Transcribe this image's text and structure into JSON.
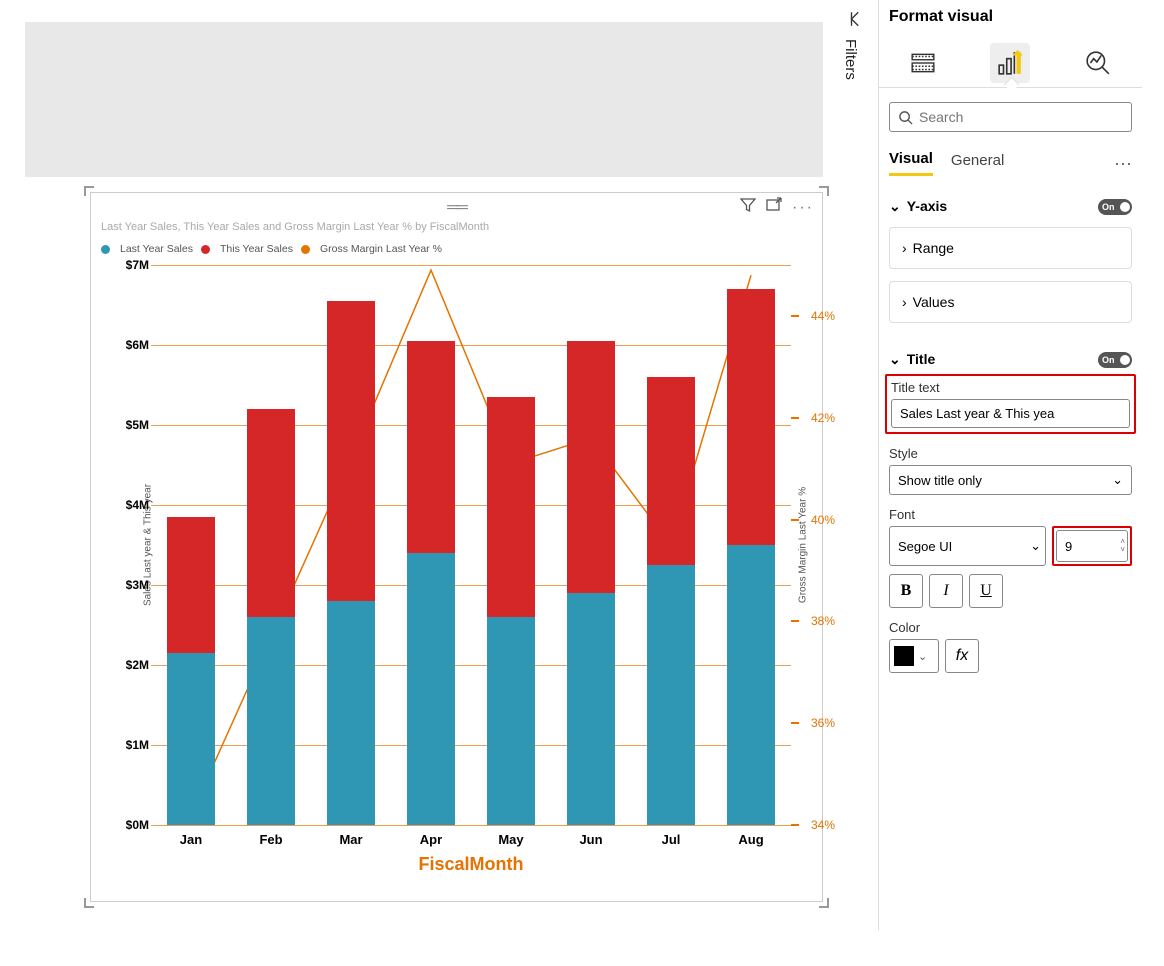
{
  "chart_data": {
    "type": "bar",
    "title_text": "Last Year Sales, This Year Sales and Gross Margin Last Year % by FiscalMonth",
    "xlabel": "FiscalMonth",
    "ylabel_left": "Sales Last year & This year",
    "ylabel_right": "Gross Margin Last Year %",
    "categories": [
      "Jan",
      "Feb",
      "Mar",
      "Apr",
      "May",
      "Jun",
      "Jul",
      "Aug"
    ],
    "y1_ticks": [
      "$0M",
      "$1M",
      "$2M",
      "$3M",
      "$4M",
      "$5M",
      "$6M",
      "$7M"
    ],
    "y1_range": [
      0,
      7
    ],
    "series": [
      {
        "name": "Last Year Sales",
        "color": "#2f96b4",
        "values": [
          2.15,
          2.6,
          2.8,
          3.4,
          2.6,
          2.9,
          3.25,
          3.5
        ]
      },
      {
        "name": "This Year Sales",
        "color": "#d62728",
        "values": [
          1.7,
          2.6,
          3.75,
          2.65,
          2.75,
          3.15,
          2.35,
          3.2
        ]
      }
    ],
    "y2_ticks": [
      "34%",
      "36%",
      "38%",
      "40%",
      "42%",
      "44%"
    ],
    "y2_range": [
      34,
      45
    ],
    "line_series": {
      "name": "Gross Margin Last Year %",
      "color": "#e67300",
      "values": [
        34.2,
        37.7,
        41.2,
        44.9,
        41.1,
        41.6,
        39.5,
        44.8
      ]
    },
    "legend": [
      {
        "label": "Last Year Sales",
        "color": "#2f96b4"
      },
      {
        "label": "This Year Sales",
        "color": "#d62728"
      },
      {
        "label": "Gross Margin Last Year %",
        "color": "#e67300"
      }
    ]
  },
  "filters_label": "Filters",
  "format_panel": {
    "title": "Format visual",
    "search_placeholder": "Search",
    "tabs": {
      "visual": "Visual",
      "general": "General"
    },
    "yaxis": {
      "label": "Y-axis",
      "toggle": "On",
      "range": "Range",
      "values": "Values"
    },
    "title_section": {
      "label": "Title",
      "toggle": "On",
      "title_text_label": "Title text",
      "title_text_value": "Sales Last year & This yea",
      "style_label": "Style",
      "style_value": "Show title only",
      "font_label": "Font",
      "font_family": "Segoe UI",
      "font_size": "9",
      "bold": "B",
      "italic": "I",
      "underline": "U",
      "color_label": "Color",
      "color_value": "#000000",
      "fx": "fx"
    }
  }
}
